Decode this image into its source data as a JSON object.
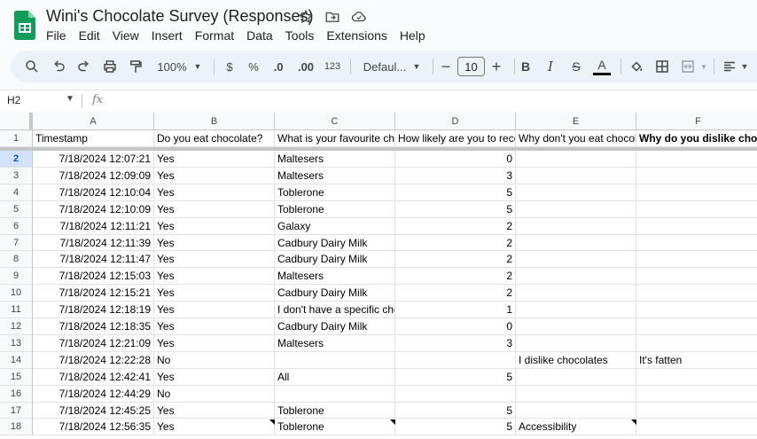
{
  "app": {
    "title": "Wini's Chocolate Survey (Responses)",
    "menu": [
      "File",
      "Edit",
      "View",
      "Insert",
      "Format",
      "Data",
      "Tools",
      "Extensions",
      "Help"
    ]
  },
  "toolbar": {
    "zoom": "100%",
    "currency": "$",
    "percent": "%",
    "decimal_decrease": ".0",
    "decimal_increase": ".00",
    "number_format": "123",
    "font": "Defaul...",
    "font_size": "10",
    "minus": "−",
    "plus": "+",
    "bold": "B",
    "italic": "I",
    "strike": "S",
    "text_color": "A"
  },
  "formula_bar": {
    "name_box": "H2",
    "fx": "fx"
  },
  "sheet": {
    "columns": [
      "A",
      "B",
      "C",
      "D",
      "E",
      "F"
    ],
    "header_row": [
      "Timestamp",
      "Do you eat chocolate?",
      "What is your favourite chocolate?",
      "How likely are you to recommend",
      "Why don't you eat chocolate?",
      "Why do you dislike chocolate?"
    ],
    "rows": [
      {
        "n": "2",
        "a": "7/18/2024 12:07:21",
        "b": "Yes",
        "c": "Maltesers",
        "d": "0",
        "e": "",
        "f": ""
      },
      {
        "n": "3",
        "a": "7/18/2024 12:09:09",
        "b": "Yes",
        "c": "Maltesers",
        "d": "3",
        "e": "",
        "f": ""
      },
      {
        "n": "4",
        "a": "7/18/2024 12:10:04",
        "b": "Yes",
        "c": "Toblerone",
        "d": "5",
        "e": "",
        "f": ""
      },
      {
        "n": "5",
        "a": "7/18/2024 12:10:09",
        "b": "Yes",
        "c": "Toblerone",
        "d": "5",
        "e": "",
        "f": ""
      },
      {
        "n": "6",
        "a": "7/18/2024 12:11:21",
        "b": "Yes",
        "c": "Galaxy",
        "d": "2",
        "e": "",
        "f": ""
      },
      {
        "n": "7",
        "a": "7/18/2024 12:11:39",
        "b": "Yes",
        "c": "Cadbury Dairy Milk",
        "d": "2",
        "e": "",
        "f": ""
      },
      {
        "n": "8",
        "a": "7/18/2024 12:11:47",
        "b": "Yes",
        "c": "Cadbury Dairy Milk",
        "d": "2",
        "e": "",
        "f": ""
      },
      {
        "n": "9",
        "a": "7/18/2024 12:15:03",
        "b": "Yes",
        "c": "Maltesers",
        "d": "2",
        "e": "",
        "f": ""
      },
      {
        "n": "10",
        "a": "7/18/2024 12:15:21",
        "b": "Yes",
        "c": "Cadbury Dairy Milk",
        "d": "2",
        "e": "",
        "f": ""
      },
      {
        "n": "11",
        "a": "7/18/2024 12:18:19",
        "b": "Yes",
        "c": "I don't have a specific chocolate",
        "d": "1",
        "e": "",
        "f": ""
      },
      {
        "n": "12",
        "a": "7/18/2024 12:18:35",
        "b": "Yes",
        "c": "Cadbury Dairy Milk",
        "d": "0",
        "e": "",
        "f": ""
      },
      {
        "n": "13",
        "a": "7/18/2024 12:21:09",
        "b": "Yes",
        "c": "Maltesers",
        "d": "3",
        "e": "",
        "f": ""
      },
      {
        "n": "14",
        "a": "7/18/2024 12:22:28",
        "b": "No",
        "c": "",
        "d": "",
        "e": "I dislike chocolates",
        "f": "It's fatten"
      },
      {
        "n": "15",
        "a": "7/18/2024 12:42:41",
        "b": "Yes",
        "c": "All",
        "d": "5",
        "e": "",
        "f": ""
      },
      {
        "n": "16",
        "a": "7/18/2024 12:44:29",
        "b": "No",
        "c": "",
        "d": "",
        "e": "",
        "f": ""
      },
      {
        "n": "17",
        "a": "7/18/2024 12:45:25",
        "b": "Yes",
        "c": "Toblerone",
        "d": "5",
        "e": "",
        "f": ""
      },
      {
        "n": "18",
        "a": "7/18/2024 12:56:35",
        "b": "Yes",
        "c": "Toblerone",
        "d": "5",
        "e": "Accessibility",
        "f": ""
      }
    ]
  }
}
